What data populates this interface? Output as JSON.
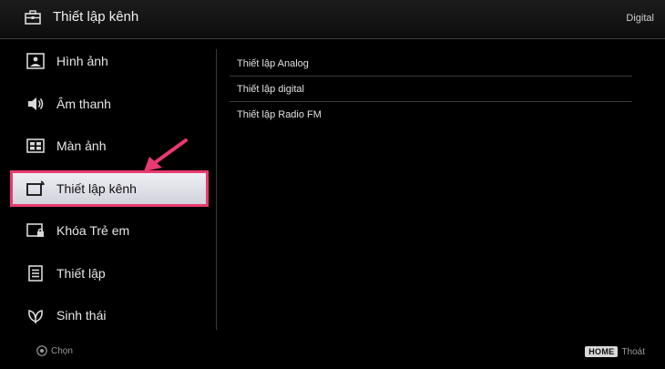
{
  "header": {
    "title": "Thiết lập kênh",
    "mode": "Digital",
    "icon": "toolbox-icon"
  },
  "menu": {
    "items": [
      {
        "label": "Hình ảnh",
        "icon": "picture-icon"
      },
      {
        "label": "Âm thanh",
        "icon": "speaker-icon"
      },
      {
        "label": "Màn ảnh",
        "icon": "screen-icon"
      },
      {
        "label": "Thiết lập kênh",
        "icon": "channel-setup-icon",
        "selected": true
      },
      {
        "label": "Khóa Trẻ em",
        "icon": "parental-lock-icon"
      },
      {
        "label": "Thiết lập",
        "icon": "settings-icon"
      },
      {
        "label": "Sinh thái",
        "icon": "eco-icon"
      }
    ]
  },
  "submenu": {
    "items": [
      {
        "label": "Thiết lập Analog"
      },
      {
        "label": "Thiết lập digital"
      },
      {
        "label": "Thiết lập Radio FM"
      }
    ]
  },
  "footer": {
    "select_label": "Chọn",
    "home_key": "HOME",
    "exit_label": "Thoát"
  },
  "colors": {
    "highlight_border": "#e83a70",
    "arrow": "#e83a70",
    "background": "#000000"
  }
}
